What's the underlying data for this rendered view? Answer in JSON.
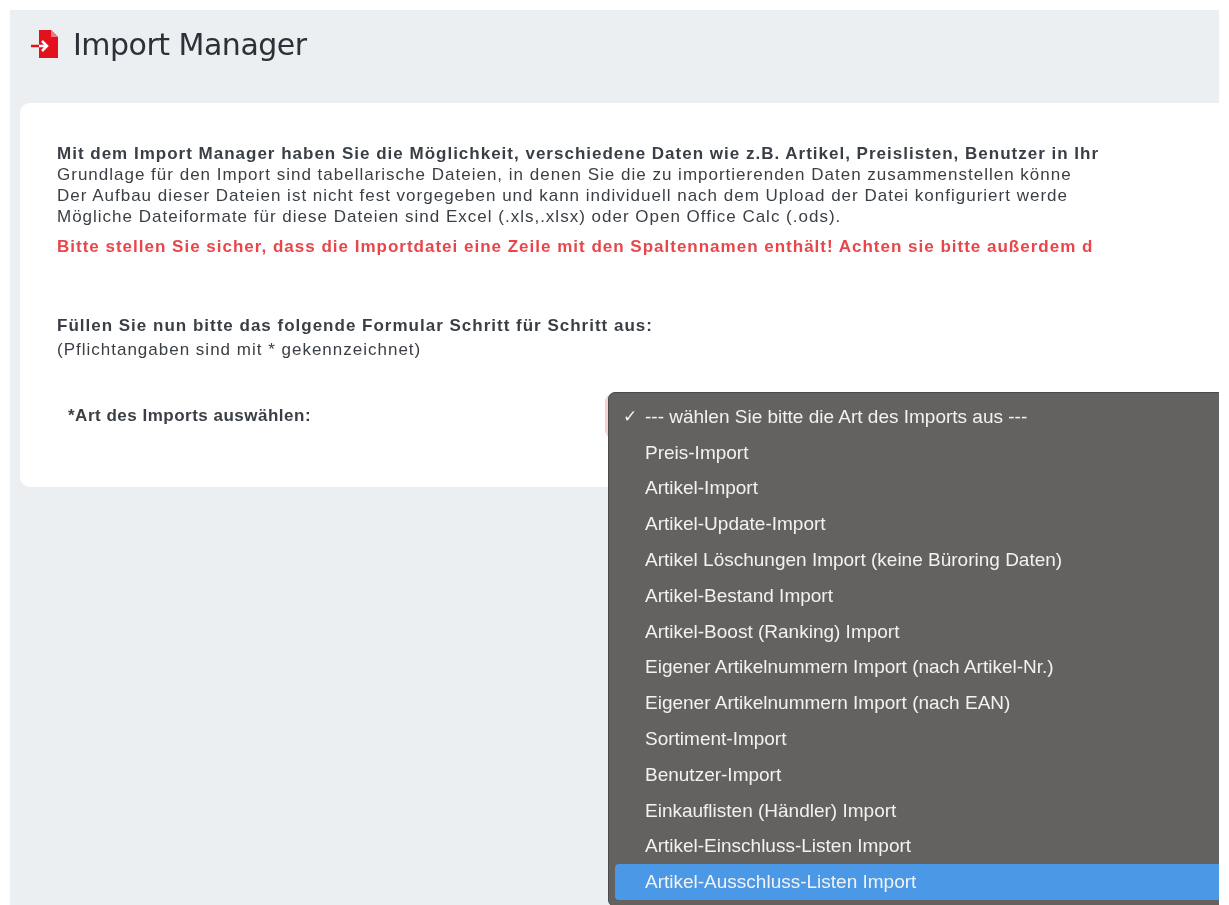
{
  "header": {
    "title": "Import Manager"
  },
  "intro": {
    "lead": "Mit dem Import Manager haben Sie die Möglichkeit, verschiedene Daten wie z.B. Artikel, Preislisten, Benutzer in Ihr",
    "lines": [
      "Grundlage für den Import sind tabellarische Dateien, in denen Sie die zu importierenden Daten zusammenstellen könne",
      "Der Aufbau dieser Dateien ist nicht fest vorgegeben und kann individuell nach dem Upload der Datei konfiguriert werde",
      "Mögliche Dateiformate für diese Dateien sind Excel (.xls,.xlsx) oder Open Office Calc (.ods)."
    ]
  },
  "warning": "Bitte stellen Sie sicher, dass die Importdatei eine Zeile mit den Spaltennamen enthält! Achten sie bitte außerdem d",
  "instructions": {
    "heading": "Füllen Sie nun bitte das folgende Formular Schritt für Schritt aus:",
    "note": "(Pflichtangaben sind mit * gekennzeichnet)"
  },
  "form": {
    "label": "*Art des Imports auswählen:",
    "select": {
      "invalid": true,
      "expanded": true,
      "check_mark": "✓",
      "options": [
        {
          "label": "--- wählen Sie bitte die Art des Imports aus ---",
          "checked": true,
          "highlighted": false
        },
        {
          "label": "Preis-Import",
          "checked": false,
          "highlighted": false
        },
        {
          "label": "Artikel-Import",
          "checked": false,
          "highlighted": false
        },
        {
          "label": "Artikel-Update-Import",
          "checked": false,
          "highlighted": false
        },
        {
          "label": "Artikel Löschungen Import (keine Büroring Daten)",
          "checked": false,
          "highlighted": false
        },
        {
          "label": "Artikel-Bestand Import",
          "checked": false,
          "highlighted": false
        },
        {
          "label": "Artikel-Boost (Ranking) Import",
          "checked": false,
          "highlighted": false
        },
        {
          "label": "Eigener Artikelnummern Import (nach Artikel-Nr.)",
          "checked": false,
          "highlighted": false
        },
        {
          "label": "Eigener Artikelnummern Import (nach EAN)",
          "checked": false,
          "highlighted": false
        },
        {
          "label": "Sortiment-Import",
          "checked": false,
          "highlighted": false
        },
        {
          "label": "Benutzer-Import",
          "checked": false,
          "highlighted": false
        },
        {
          "label": "Einkauflisten (Händler) Import",
          "checked": false,
          "highlighted": false
        },
        {
          "label": "Artikel-Einschluss-Listen Import",
          "checked": false,
          "highlighted": false
        },
        {
          "label": "Artikel-Ausschluss-Listen Import",
          "checked": false,
          "highlighted": true
        }
      ]
    }
  }
}
